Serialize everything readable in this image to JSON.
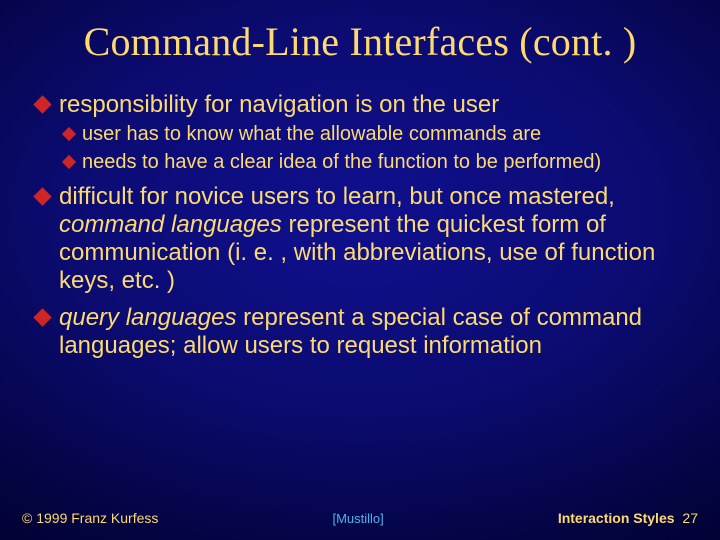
{
  "title": "Command-Line Interfaces (cont. )",
  "bullets": {
    "b1": "responsibility for navigation is on the user",
    "b1a": "user has to know what the allowable commands are",
    "b1b": "needs to have a clear idea of the function to be performed)",
    "b2_pre": "difficult for novice users to learn, but once mastered, ",
    "b2_em": "command languages",
    "b2_post": " represent the quickest form of communication (i. e. , with abbreviations, use of function keys, etc. )",
    "b3_em": "query languages",
    "b3_post": " represent a special case of command languages; allow users to request information"
  },
  "footer": {
    "copyright": "© 1999 Franz Kurfess",
    "citation": "[Mustillo]",
    "section": "Interaction Styles",
    "page": "27"
  }
}
